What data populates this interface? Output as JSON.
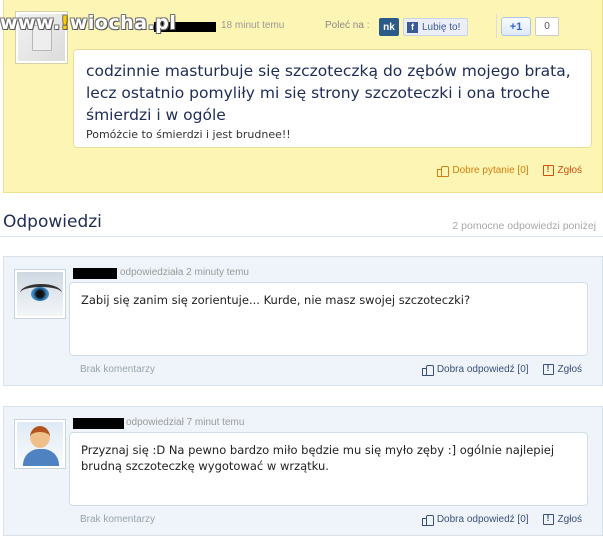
{
  "watermark": {
    "prefix": "www.",
    "excl": "!",
    "rest": "wiocha.pl"
  },
  "question": {
    "time": "18 minut temu",
    "share_label": "Poleć na :",
    "nk_label": "nk",
    "fb_label": "Lubię to!",
    "gplus_label": "+1",
    "gplus_count": "0",
    "title": "codzinnie masturbuje się szczoteczką do zębów mojego brata, lecz ostatnio pomyliły mi się strony szczoteczki i ona troche śmierdzi i w ogóle",
    "description": "Pomóżcie to śmierdzi i jest brudnee!!",
    "good_question_label": "Dobre pytanie [0]",
    "report_label": "Zgłoś"
  },
  "answers_header": {
    "title": "Odpowiedzi",
    "count_text": "2 pomocne odpowiedzi poniżej"
  },
  "answers": [
    {
      "time": "odpowiedziała 2 minuty temu",
      "text": "Zabij się zanim się zorientuje... Kurde, nie masz swojej szczoteczki?",
      "comments": "Brak komentarzy",
      "good_answer_label": "Dobra odpowiedź [0]",
      "report_label": "Zgłoś"
    },
    {
      "time": "odpowiedział 7 minut temu",
      "text": "Przyznaj się :D Na pewno bardzo miło będzie mu się myło zęby :] ogólnie najlepiej brudną szczoteczkę wygotować w wrzątku.",
      "comments": "Brak komentarzy",
      "good_answer_label": "Dobra odpowiedź [0]",
      "report_label": "Zgłoś"
    }
  ]
}
